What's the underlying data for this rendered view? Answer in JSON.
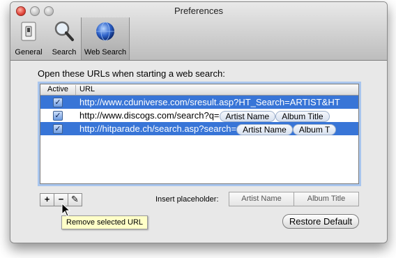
{
  "window": {
    "title": "Preferences"
  },
  "toolbar": {
    "items": [
      {
        "label": "General",
        "icon": "switch-icon"
      },
      {
        "label": "Search",
        "icon": "magnifier-icon"
      },
      {
        "label": "Web Search",
        "icon": "globe-icon"
      }
    ],
    "selected": "Web Search"
  },
  "main": {
    "prompt": "Open these URLs when starting a web search:",
    "table": {
      "columns": [
        "Active",
        "URL"
      ],
      "rows": [
        {
          "active": true,
          "selected": true,
          "url": "http://www.cduniverse.com/sresult.asp?HT_Search=ARTIST&HT",
          "tokens": []
        },
        {
          "active": true,
          "selected": false,
          "url": "http://www.discogs.com/search?q=",
          "tokens": [
            "Artist Name",
            "Album Title"
          ]
        },
        {
          "active": true,
          "selected": true,
          "url": "http://hitparade.ch/search.asp?search=",
          "tokens": [
            "Artist Name",
            "Album T"
          ]
        }
      ]
    },
    "buttons": {
      "add": "+",
      "remove": "−",
      "edit": "✎"
    },
    "insert_label": "Insert placeholder:",
    "placeholders": [
      "Artist Name",
      "Album Title"
    ],
    "restore_label": "Restore Default",
    "tooltip": "Remove selected URL"
  },
  "colors": {
    "selection": "#3875d7",
    "focus_ring": "#a9c6ee",
    "tooltip_bg": "#ffffc8"
  }
}
